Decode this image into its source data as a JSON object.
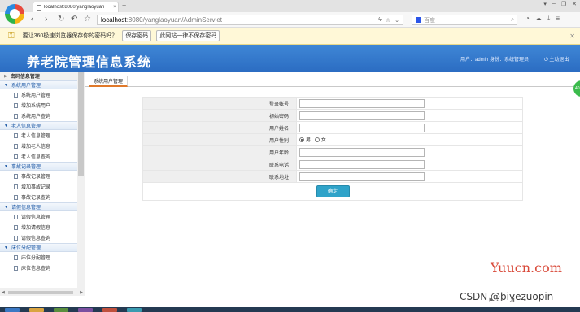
{
  "browser": {
    "tab_title": "localhost:8080/yanglaoyuan",
    "tab_close": "×",
    "new_tab": "+",
    "window_controls": [
      "▾",
      "–",
      "❐",
      "✕"
    ],
    "url_host": "localhost",
    "url_path": ":8080/yanglaoyuan/AdminServlet",
    "search_placeholder": "百度",
    "nav_icons": [
      "back-icon",
      "forward-icon",
      "reload-icon",
      "undo-icon",
      "star-icon"
    ]
  },
  "password_bar": {
    "message": "要让360极速浏览器保存你的密码吗？",
    "save_label": "保存密码",
    "never_label": "此网站一律不保存密码",
    "close": "✕"
  },
  "header": {
    "title": "养老院管理信息系统",
    "user_info": "用户：admin 身份：系统管理员",
    "logout": "主动退出"
  },
  "sidebar": {
    "top_item": "密码信息管理",
    "groups": [
      {
        "label": "系统用户管理",
        "items": [
          "系统用户管理",
          "增加系统用户",
          "系统用户查询"
        ]
      },
      {
        "label": "老人信息管理",
        "items": [
          "老人信息管理",
          "增加老人信息",
          "老人信息查询"
        ]
      },
      {
        "label": "事故记录管理",
        "items": [
          "事故记录管理",
          "增加事故记录",
          "事故记录查询"
        ]
      },
      {
        "label": "请假信息管理",
        "items": [
          "请假信息管理",
          "增加请假信息",
          "请假信息查询"
        ]
      },
      {
        "label": "床位分配管理",
        "items": [
          "床位分配管理",
          "床位信息查询"
        ]
      }
    ]
  },
  "main": {
    "tab_label": "系统用户管理",
    "form": {
      "login_label": "登录帐号：",
      "password_label": "初始密码：",
      "name_label": "用户姓名：",
      "gender_label": "用户性别：",
      "gender_male": "男",
      "gender_female": "女",
      "age_label": "用户年龄：",
      "phone_label": "联系电话：",
      "address_label": "联系地址：",
      "submit_label": "确定"
    }
  },
  "watermarks": {
    "site": "Yuucn.com",
    "csdn": "CSDN @biyezuopin"
  },
  "colors": {
    "header_blue": "#2b6cc2",
    "sidebar_group_text": "#1f5aa6",
    "tab_accent": "#e0792a",
    "submit_button": "#2fa3c9",
    "password_bar": "#fff8d7"
  }
}
